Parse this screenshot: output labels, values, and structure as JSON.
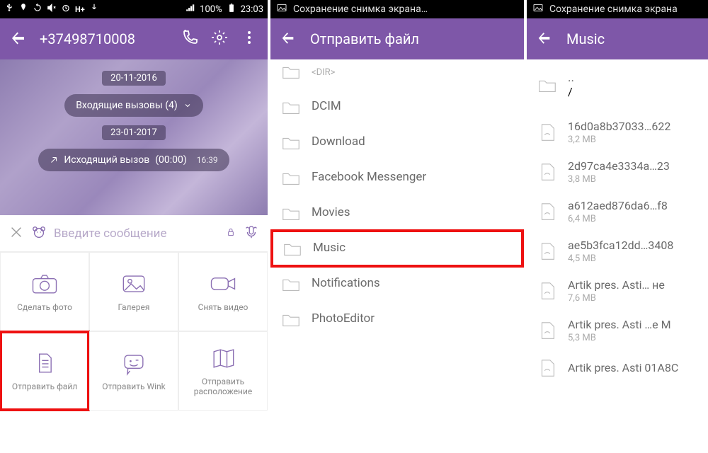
{
  "panel1": {
    "status": {
      "icons": [
        "usb",
        "pin",
        "refresh",
        "mute",
        "alarm",
        "hplus",
        "down",
        "signal",
        "battery_text",
        "battery"
      ],
      "battery_text": "100%",
      "time": "23:03"
    },
    "appbar": {
      "phone": "+37498710008"
    },
    "chat": {
      "date1": "20-11-2016",
      "row1": "Входящие вызовы  (4)",
      "date2": "23-01-2017",
      "row2_label": "Исходящий вызов",
      "row2_dur": "(00:00)",
      "row2_time": "16:39"
    },
    "input": {
      "placeholder": "Введите сообщение"
    },
    "tiles": [
      {
        "id": "photo",
        "label": "Сделать фото"
      },
      {
        "id": "gallery",
        "label": "Галерея"
      },
      {
        "id": "video",
        "label": "Снять видео"
      },
      {
        "id": "sendfile",
        "label": "Отправить файл"
      },
      {
        "id": "wink",
        "label": "Отправить Wink"
      },
      {
        "id": "location",
        "label": "Отправить расположение"
      }
    ]
  },
  "panel2": {
    "status": {
      "label": "Сохранение снимка экрана…"
    },
    "appbar": {
      "title": "Отправить файл"
    },
    "dir_label": "<DIR>",
    "folders": [
      {
        "name": "DCIM"
      },
      {
        "name": "Download"
      },
      {
        "name": "Facebook Messenger"
      },
      {
        "name": "Movies"
      },
      {
        "name": "Music",
        "highlight": true
      },
      {
        "name": "Notifications"
      },
      {
        "name": "PhotoEditor"
      }
    ],
    "top_partial_dir": "<DIR>"
  },
  "panel3": {
    "status": {
      "label": "Сохранение снимка экрана"
    },
    "appbar": {
      "title": "Music"
    },
    "up": {
      "name": "..",
      "sub": "/"
    },
    "files": [
      {
        "name": "16d0a8b37033…622",
        "size": "3,2 MB"
      },
      {
        "name": "2d97ca4e3334a…23",
        "size": "3,8 MB"
      },
      {
        "name": "a612aed876da6…f8",
        "size": "6,4 MB"
      },
      {
        "name": "ae5b3fca12dd…3408",
        "size": "4,5 MB"
      },
      {
        "name": "Artik pres. Asti… не",
        "size": "7,6 MB"
      },
      {
        "name": "Artik pres. Asti …e M",
        "size": "5,3 MB"
      },
      {
        "name": "Artik pres. Asti 01A8C",
        "size": ""
      }
    ]
  }
}
